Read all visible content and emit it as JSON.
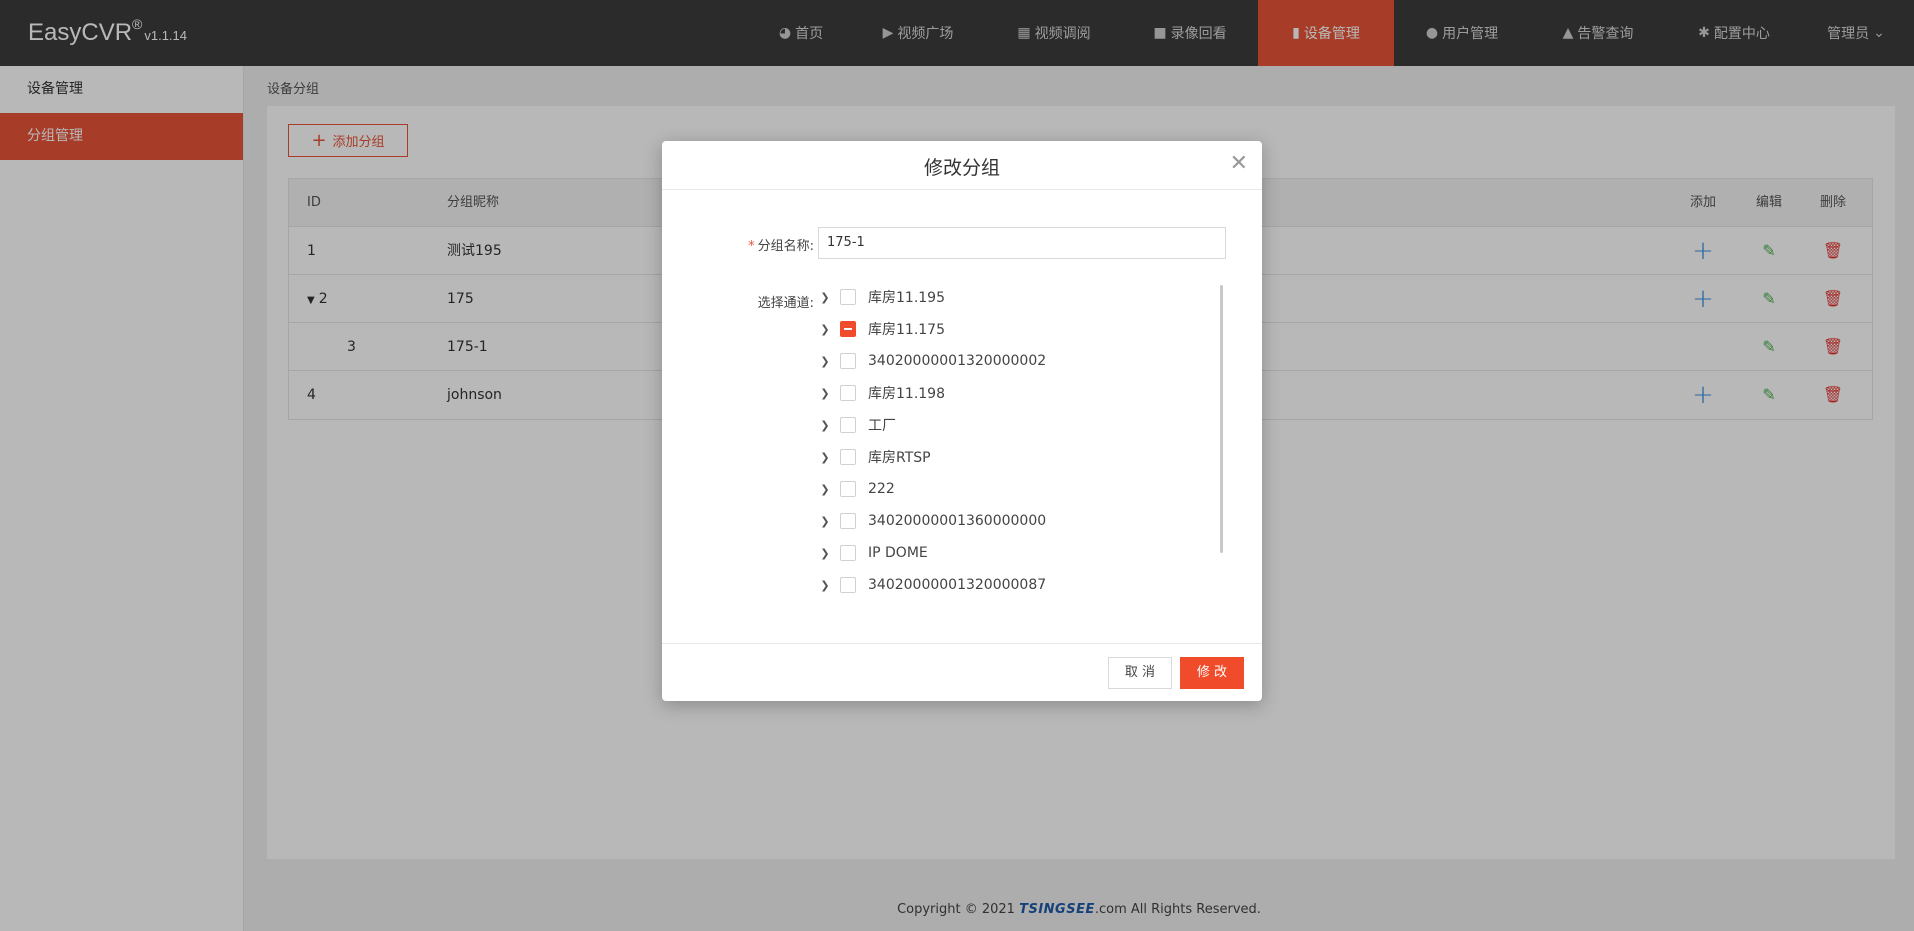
{
  "app": {
    "brand": "EasyCVR",
    "reg": "®",
    "version": "v1.1.14"
  },
  "nav": [
    {
      "label": "首页",
      "icon": "dashboard-icon",
      "glyph": "◕"
    },
    {
      "label": "视频广场",
      "icon": "play-icon",
      "glyph": "▶"
    },
    {
      "label": "视频调阅",
      "icon": "grid-icon",
      "glyph": "▦"
    },
    {
      "label": "录像回看",
      "icon": "camera-icon",
      "glyph": "■"
    },
    {
      "label": "设备管理",
      "icon": "device-icon",
      "glyph": "▮"
    },
    {
      "label": "用户管理",
      "icon": "user-icon",
      "glyph": "●"
    },
    {
      "label": "告警查询",
      "icon": "alarm-icon",
      "glyph": "▲"
    },
    {
      "label": "配置中心",
      "icon": "gear-icon",
      "glyph": "✱"
    },
    {
      "label": "管理员",
      "icon": "chevron-down-icon",
      "glyph": "⌄"
    }
  ],
  "sidebar": {
    "items": [
      {
        "label": "设备管理"
      },
      {
        "label": "分组管理"
      }
    ]
  },
  "breadcrumb": "设备分组",
  "toolbar": {
    "add_label": "添加分组"
  },
  "table": {
    "headers": {
      "id": "ID",
      "name": "分组昵称",
      "add": "添加",
      "edit": "编辑",
      "delete": "删除"
    },
    "rows": [
      {
        "id": "1",
        "name": "测试195"
      },
      {
        "id": "2",
        "name": "175",
        "expanded": true
      },
      {
        "id": "3",
        "name": "175-1",
        "child": true
      },
      {
        "id": "4",
        "name": "johnson"
      }
    ]
  },
  "footer": {
    "prefix": "Copyright © 2021 ",
    "logo": "TSINGSEE",
    "suffix": ".com All Rights Reserved."
  },
  "modal": {
    "title": "修改分组",
    "name_label": "分组名称:",
    "name_value": "175-1",
    "channel_label": "选择通道:",
    "channels": [
      {
        "label": "库房11.195",
        "state": "unchecked"
      },
      {
        "label": "库房11.175",
        "state": "partial"
      },
      {
        "label": "34020000001320000002",
        "state": "unchecked"
      },
      {
        "label": "库房11.198",
        "state": "unchecked"
      },
      {
        "label": "工厂",
        "state": "unchecked"
      },
      {
        "label": "库房RTSP",
        "state": "unchecked"
      },
      {
        "label": "222",
        "state": "unchecked"
      },
      {
        "label": "34020000001360000000",
        "state": "unchecked"
      },
      {
        "label": "IP DOME",
        "state": "unchecked"
      },
      {
        "label": "34020000001320000087",
        "state": "unchecked"
      }
    ],
    "cancel_label": "取 消",
    "ok_label": "修 改"
  },
  "colors": {
    "accent": "#e8553a",
    "navbar": "#3c3c3c",
    "primary_btn": "#f04b2a"
  }
}
